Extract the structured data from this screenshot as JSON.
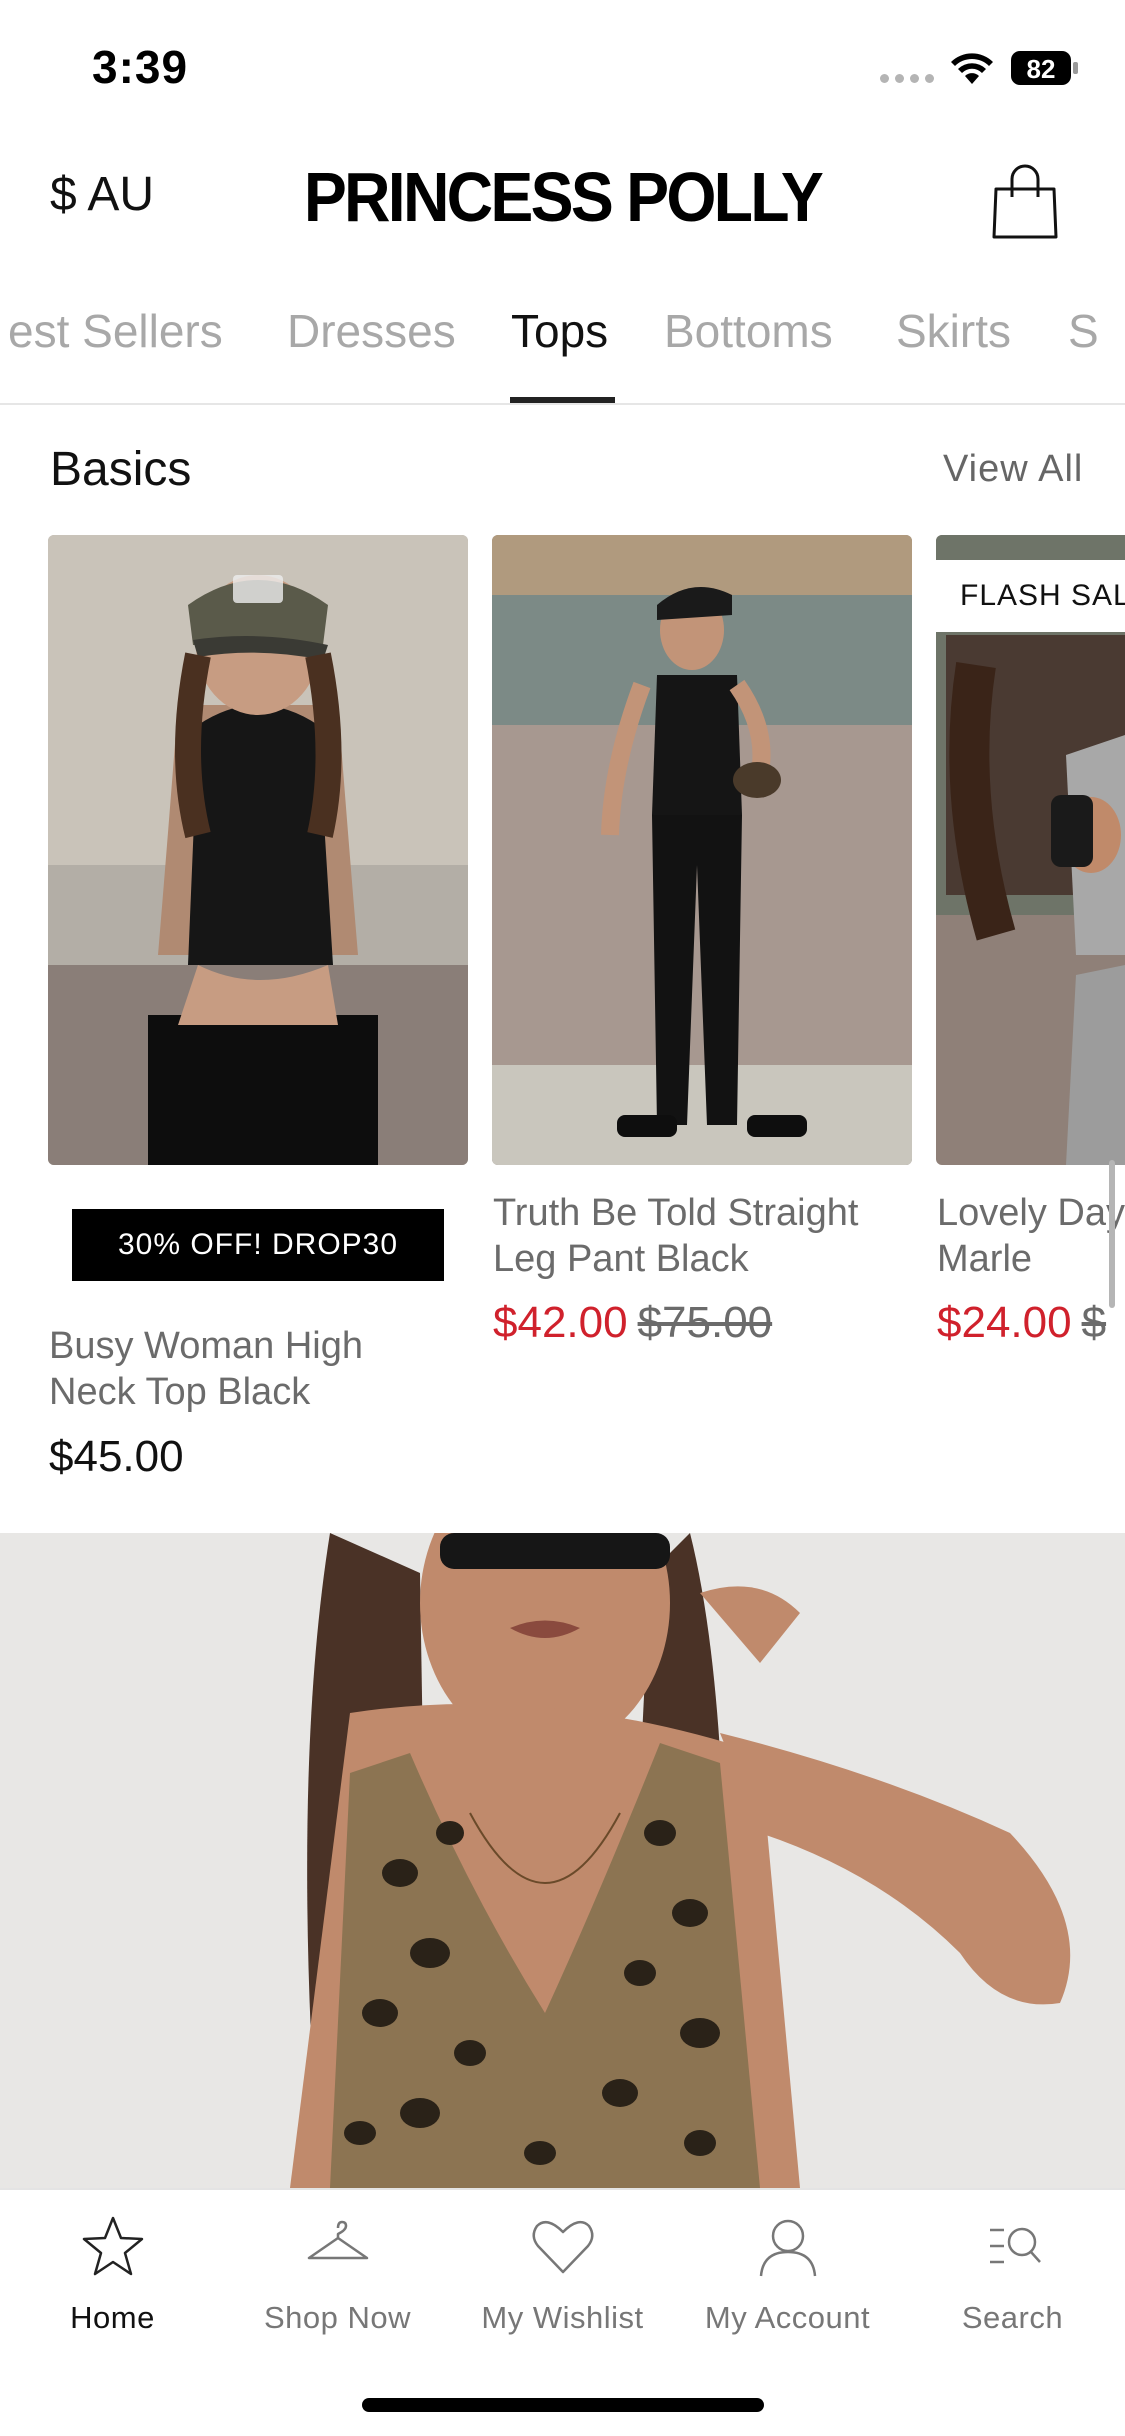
{
  "status_bar": {
    "time": "3:39",
    "battery": "82"
  },
  "header": {
    "currency": "$ AU",
    "brand": "PRINCESS POLLY"
  },
  "tabs": [
    {
      "label": "est Sellers"
    },
    {
      "label": "Dresses"
    },
    {
      "label": "Tops"
    },
    {
      "label": "Bottoms"
    },
    {
      "label": "Skirts"
    },
    {
      "label": "S"
    }
  ],
  "section": {
    "title": "Basics",
    "view_all": "View All"
  },
  "products": [
    {
      "badge": "30% OFF! DROP30",
      "name": "Busy Woman High Neck Top Black",
      "price": "$45.00"
    },
    {
      "name": "Truth Be Told Straight Leg Pant Black",
      "sale_price": "$42.00",
      "original_price": "$75.00"
    },
    {
      "badge": "FLASH SAL",
      "name": "Lovely Day Grey Marle",
      "sale_price": "$24.00",
      "original_price": "$"
    }
  ],
  "colors": {
    "sale": "#d0212c",
    "text": "#111111",
    "muted": "#6b6b6b",
    "tab_inactive": "#a8a8a8"
  },
  "bottom_nav": [
    {
      "label": "Home",
      "icon": "star-icon"
    },
    {
      "label": "Shop Now",
      "icon": "hanger-icon"
    },
    {
      "label": "My Wishlist",
      "icon": "heart-icon"
    },
    {
      "label": "My Account",
      "icon": "user-icon"
    },
    {
      "label": "Search",
      "icon": "search-list-icon"
    }
  ]
}
